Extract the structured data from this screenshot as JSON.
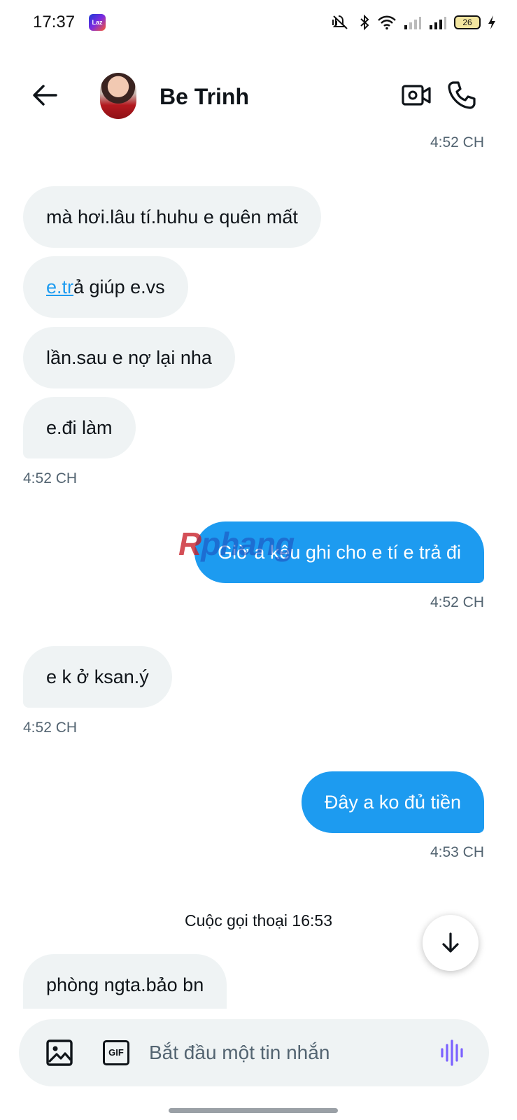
{
  "status_bar": {
    "time": "17:37",
    "app_badge": "Laz",
    "battery": "26",
    "icons": [
      "mute-icon",
      "bluetooth-icon",
      "wifi-icon",
      "signal-icon",
      "signal-icon",
      "battery-icon",
      "charging-icon"
    ]
  },
  "header": {
    "contact_name": "Be Trinh",
    "icons": [
      "back-arrow-icon",
      "video-call-icon",
      "phone-call-icon"
    ]
  },
  "chat": {
    "top_time": "4:52 CH",
    "messages": [
      {
        "sender": "them",
        "text": "mà hơi.lâu tí.huhu e quên mất"
      },
      {
        "sender": "them",
        "link_text": "e.tr",
        "text": "ả giúp e.vs"
      },
      {
        "sender": "them",
        "text": "lần.sau e nợ lại nha"
      },
      {
        "sender": "them",
        "text": "e.đi làm",
        "time": "4:52 CH"
      },
      {
        "sender": "me",
        "text": "Giờ a kêu ghi cho e tí e trả đi",
        "time": "4:52 CH"
      },
      {
        "sender": "them",
        "text": "e k ở ksan.ý",
        "time": "4:52 CH"
      },
      {
        "sender": "me",
        "text": "Đây a ko đủ tiền",
        "time": "4:53 CH"
      },
      {
        "sender": "them",
        "text": "phòng ngta.bảo bn"
      }
    ],
    "call_note": "Cuộc gọi thoại 16:53",
    "watermark": {
      "first": "R",
      "rest": "phang"
    }
  },
  "composer": {
    "placeholder": "Bắt đầu một tin nhắn",
    "gif_label": "GIF",
    "icons": [
      "image-icon",
      "gif-icon",
      "voice-icon"
    ]
  },
  "colors": {
    "accent": "#1d9bf0",
    "incoming_bubble": "#eff3f4",
    "muted_text": "#536471",
    "voice_icon": "#7b61ff"
  }
}
